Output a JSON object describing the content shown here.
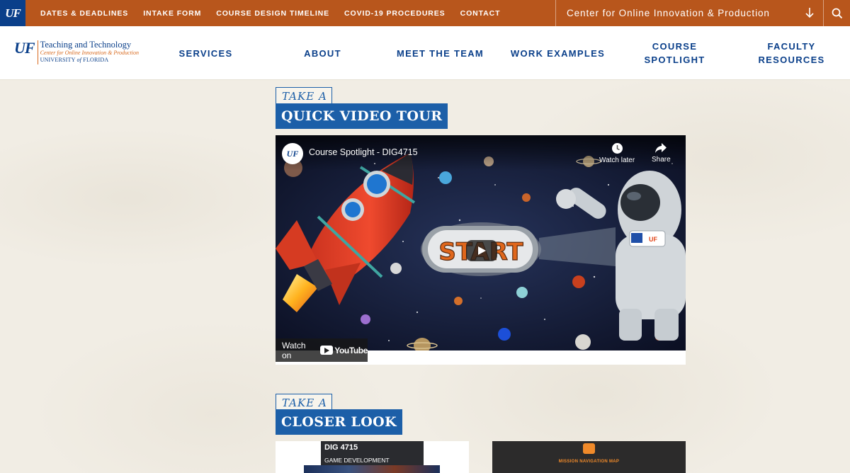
{
  "topbar": {
    "uf_logo": "UF",
    "links": [
      "DATES & DEADLINES",
      "INTAKE FORM",
      "COURSE DESIGN TIMELINE",
      "COVID-19 PROCEDURES",
      "CONTACT"
    ],
    "center_select": "Center for Online Innovation & Production",
    "bg_color": "#b8561c"
  },
  "logo": {
    "mark": "UF",
    "line1": "Teaching and Technology",
    "line2": "Center for Online Innovation & Production",
    "line3_a": "UNIVERSITY ",
    "line3_b": "of",
    "line3_c": " FLORIDA"
  },
  "nav": [
    "SERVICES",
    "ABOUT",
    "MEET THE TEAM",
    "WORK EXAMPLES",
    "COURSE\nSPOTLIGHT",
    "FACULTY\nRESOURCES"
  ],
  "section1": {
    "take_a": "TAKE A",
    "heading": "QUICK VIDEO TOUR"
  },
  "video": {
    "channel_logo": "UF",
    "title": "Course Spotlight - DIG4715",
    "watch_later": "Watch later",
    "share": "Share",
    "start_text": "START",
    "badge": "UF",
    "watch_on": "Watch on",
    "youtube": "YouTube"
  },
  "section2": {
    "take_a": "TAKE A",
    "heading": "CLOSER LOOK"
  },
  "cards": {
    "card1": {
      "code": "DIG 4715",
      "subtitle": "GAME DEVELOPMENT"
    },
    "card2": {
      "caption": "MISSION NAVIGATION MAP"
    }
  },
  "colors": {
    "uf_blue": "#0a3f8a",
    "heading_blue": "#1c5fa8",
    "orange": "#b8561c"
  }
}
